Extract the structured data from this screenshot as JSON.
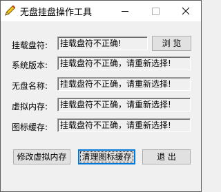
{
  "window": {
    "title": "无盘挂盘操作工具"
  },
  "rows": [
    {
      "label": "挂载盘符:",
      "value": "挂载盘符不正确!"
    },
    {
      "label": "系统版本:",
      "value": "挂载盘符不正确，请重新选择!"
    },
    {
      "label": "无盘名称:",
      "value": "挂载盘符不正确，请重新选择!"
    },
    {
      "label": "虚拟内存:",
      "value": "挂载盘符不正确，请重新选择!"
    },
    {
      "label": "图标缓存:",
      "value": "挂载盘符不正确，请重新选择!"
    }
  ],
  "buttons": {
    "browse": "浏 览",
    "modify_vmem": "修改虚拟内存",
    "clear_icon_cache": "清理图标缓存",
    "exit": "退 出"
  },
  "icons": {
    "app": "pencil-icon",
    "minimize": "minimize-icon",
    "maximize": "maximize-icon",
    "close": "close-icon"
  }
}
